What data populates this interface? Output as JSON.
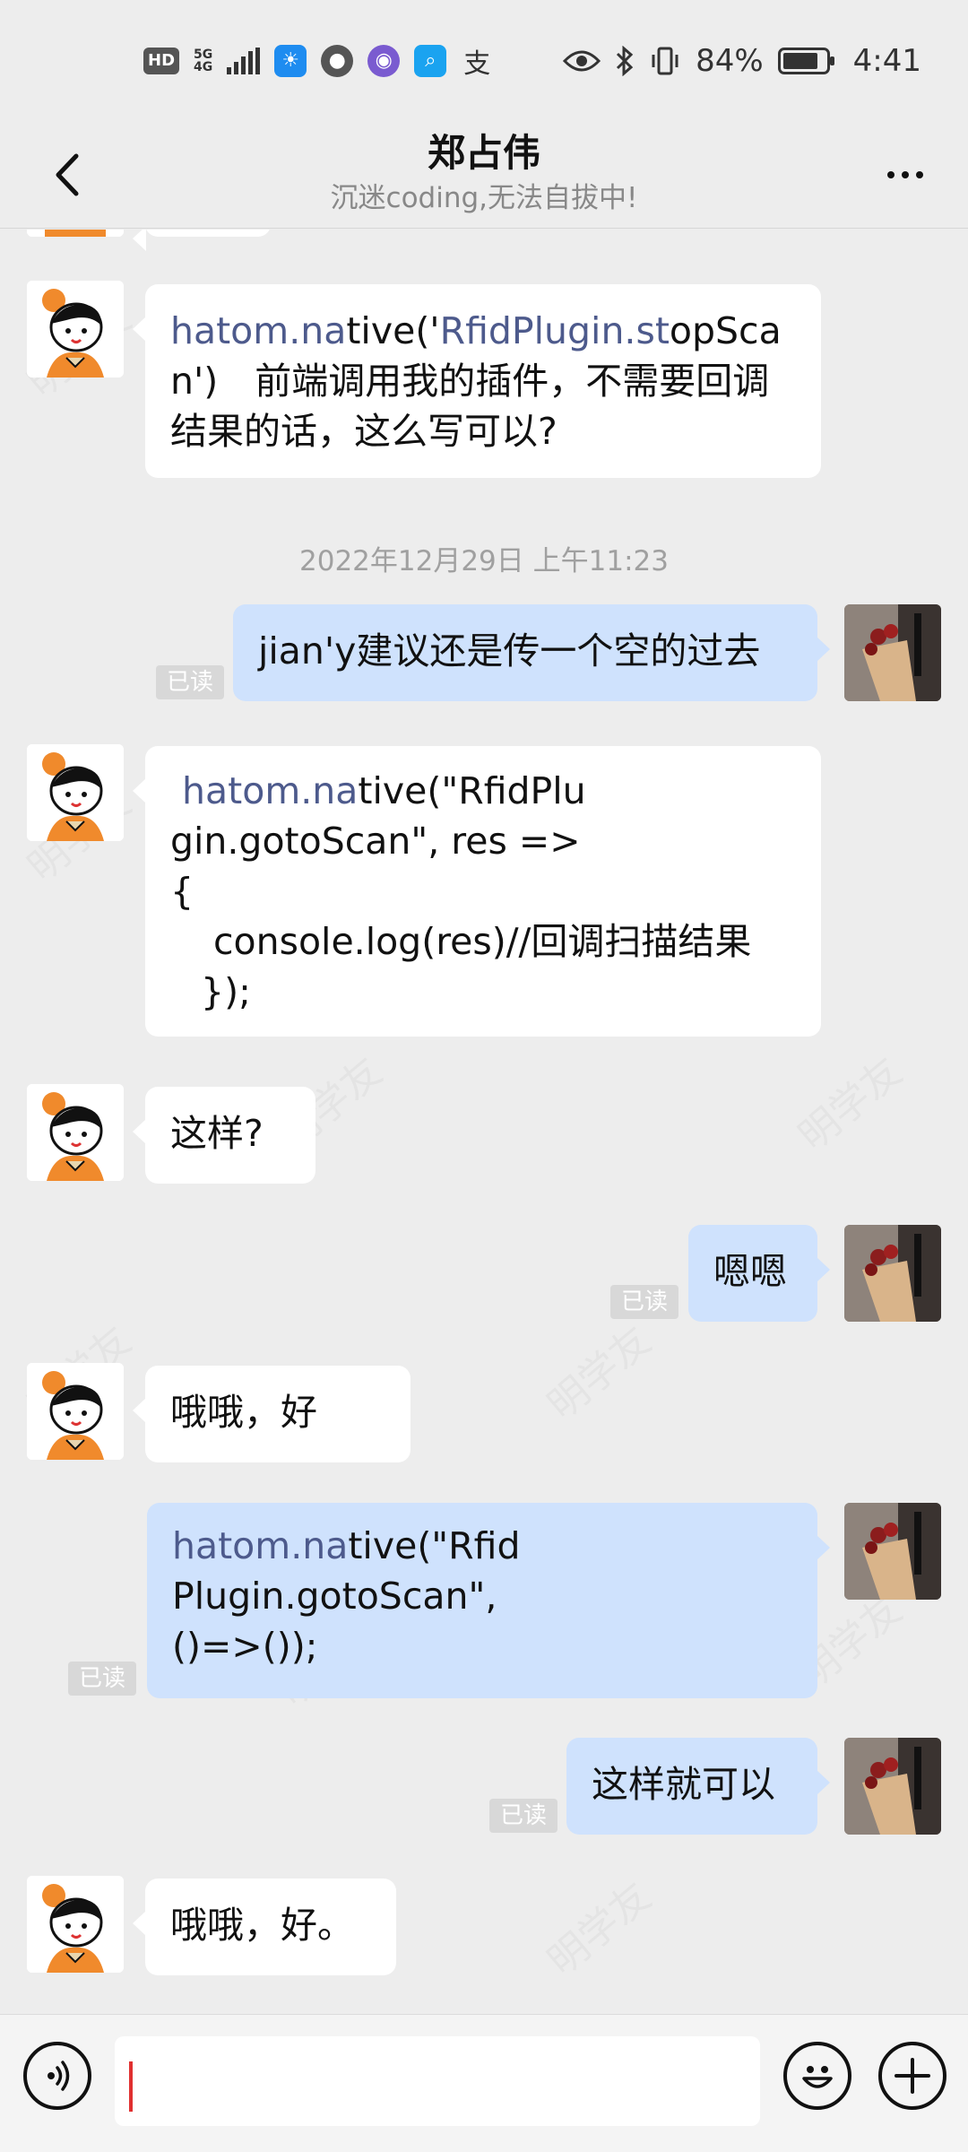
{
  "status_bar": {
    "hd_label": "HD",
    "network": "5G",
    "network_sub": "4G",
    "app_icons": [
      "weather-icon",
      "message-icon",
      "camera-icon",
      "search-app-icon",
      "alipay-icon"
    ],
    "alipay_char": "支",
    "battery_percent": "84%",
    "battery_level": 0.84,
    "time": "4:41"
  },
  "header": {
    "title": "郑占伟",
    "subtitle": "沉迷coding,无法自拔中!"
  },
  "messages": {
    "m1": {
      "hl1": "hatom.na",
      "t1": "tive('",
      "hl2": "RfidPlugin.st",
      "t2": "opScan')　前端调用我的插件，不需要回调结果的话，这么写可以?"
    },
    "timestamp": "2022年12月29日 上午11:23",
    "m2": {
      "text": "jian'y建议还是传一个空的过去",
      "read": "已读"
    },
    "m3": {
      "hl": "hatom.na",
      "line1": "tive(\"RfidPlu",
      "line2": "gin.gotoScan\", res =>",
      "line3": "{",
      "line4": "console.log(res)//回调扫描结果",
      "line5": "});"
    },
    "m4": {
      "text": "这样?"
    },
    "m5": {
      "text": "嗯嗯",
      "read": "已读"
    },
    "m6": {
      "text": "哦哦，好"
    },
    "m7": {
      "hl": "hatom.na",
      "line1": "tive(\"Rfid",
      "line2": "Plugin.gotoScan\",",
      "line3": "()=>());",
      "read": "已读"
    },
    "m8": {
      "text": "这样就可以",
      "read": "已读"
    },
    "m9": {
      "text": "哦哦，好。"
    }
  },
  "watermark": "明学友",
  "input": {
    "value": "",
    "placeholder": ""
  },
  "colors": {
    "self_bubble": "#cfe2fd",
    "other_bubble": "#ffffff",
    "highlight": "#4d5a8c",
    "background": "#ededed"
  }
}
